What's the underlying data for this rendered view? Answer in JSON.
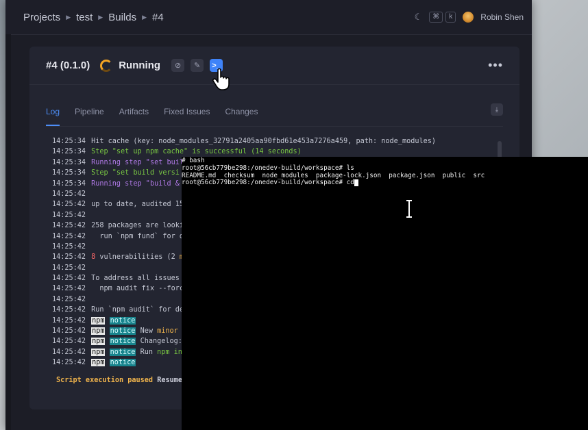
{
  "breadcrumb": [
    "Projects",
    "test",
    "Builds",
    "#4"
  ],
  "user": {
    "name": "Robin Shen"
  },
  "shortcut": {
    "keys": [
      "⌘",
      "k"
    ]
  },
  "build": {
    "title": "#4 (0.1.0)",
    "status": "Running"
  },
  "tabs": [
    "Log",
    "Pipeline",
    "Artifacts",
    "Fixed Issues",
    "Changes"
  ],
  "log": [
    {
      "ts": "14:25:34",
      "text": "Hit cache (key: node_modules_32791a2405aa90fbd61e453a7276a459, path: node_modules)",
      "style": "plain"
    },
    {
      "ts": "14:25:34",
      "text": "Step \"set up npm cache\" is successful (14 seconds)",
      "style": "green"
    },
    {
      "ts": "14:25:34",
      "text": "Running step \"set buil",
      "style": "purple"
    },
    {
      "ts": "14:25:34",
      "text": "Step \"set build versi",
      "style": "green"
    },
    {
      "ts": "14:25:34",
      "text": "Running step \"build &",
      "style": "purple"
    },
    {
      "ts": "14:25:42",
      "text": "",
      "style": "plain"
    },
    {
      "ts": "14:25:42",
      "text": "up to date, audited 15",
      "style": "plain"
    },
    {
      "ts": "14:25:42",
      "text": "",
      "style": "plain"
    },
    {
      "ts": "14:25:42",
      "text": "258 packages are looki",
      "style": "plain"
    },
    {
      "ts": "14:25:42",
      "text": "  run `npm fund` for d",
      "style": "plain"
    },
    {
      "ts": "14:25:42",
      "text": "",
      "style": "plain"
    },
    {
      "ts": "14:25:42",
      "text": "8 vulnerabilities (2 m",
      "style": "vuln"
    },
    {
      "ts": "14:25:42",
      "text": "",
      "style": "plain"
    },
    {
      "ts": "14:25:42",
      "text": "To address all issues",
      "style": "plain"
    },
    {
      "ts": "14:25:42",
      "text": "  npm audit fix --forc",
      "style": "plain"
    },
    {
      "ts": "14:25:42",
      "text": "",
      "style": "plain"
    },
    {
      "ts": "14:25:42",
      "text": "Run `npm audit` for de",
      "style": "plain"
    },
    {
      "ts": "14:25:42",
      "text": "",
      "style": "npm"
    },
    {
      "ts": "14:25:42",
      "text": "New minor v",
      "style": "npm-minor"
    },
    {
      "ts": "14:25:42",
      "text": "Changelog: ",
      "style": "npm"
    },
    {
      "ts": "14:25:42",
      "text": "Run npm ins",
      "style": "npm-run"
    },
    {
      "ts": "14:25:42",
      "text": "",
      "style": "npm"
    }
  ],
  "npm_tags": {
    "npm": "npm",
    "notice": "notice",
    "minor": "minor",
    "npm_ins": "npm ins",
    "run": "Run ",
    "new": "New ",
    "v": " v"
  },
  "vuln": {
    "num": "8",
    "rest_a": " vulnerabilities (2 ",
    "rest_b": "m"
  },
  "paused": {
    "label": "Script execution paused",
    "action": "Resume"
  },
  "terminal": {
    "lines": [
      "# bash",
      "root@56cb779be298:/onedev-build/workspace# ls",
      "README.md  checksum  node_modules  package-lock.json  package.json  public  src",
      "root@56cb779be298:/onedev-build/workspace# cd"
    ]
  },
  "colors": {
    "accent": "#3f83f8",
    "running": "#f5a524",
    "success": "#7ac943",
    "running_step": "#b17ae8",
    "warning": "#f0b44c"
  }
}
